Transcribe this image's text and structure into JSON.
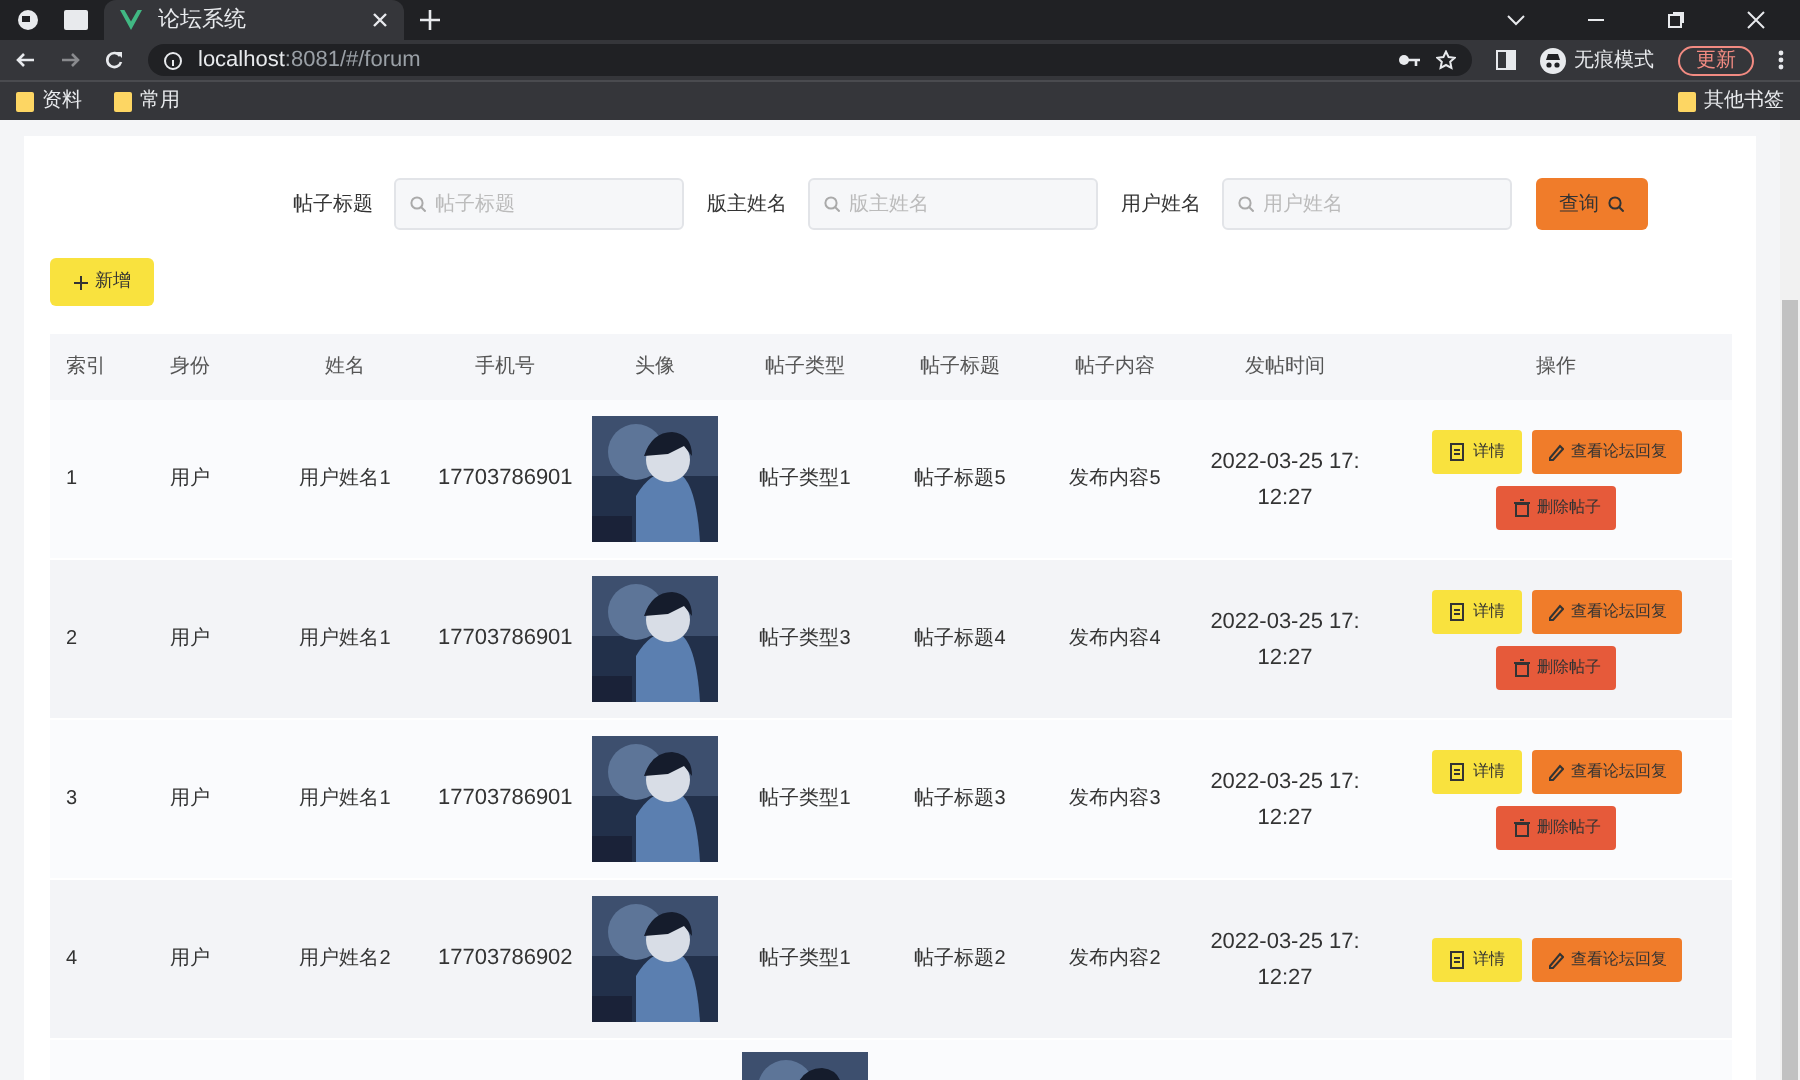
{
  "browser": {
    "tabs": [
      {
        "title": "论坛系统",
        "selected": true
      }
    ],
    "address_host": "localhost",
    "address_rest": ":8081/#/forum",
    "profile_label": "无痕模式",
    "update_button": "更新",
    "bookmarks": [
      {
        "label": "资料"
      },
      {
        "label": "常用"
      }
    ],
    "other_bookmarks": "其他书签"
  },
  "search": {
    "fields": [
      {
        "label": "帖子标题",
        "placeholder": "帖子标题"
      },
      {
        "label": "版主姓名",
        "placeholder": "版主姓名"
      },
      {
        "label": "用户姓名",
        "placeholder": "用户姓名"
      }
    ],
    "button": "查询"
  },
  "add_button": "新增",
  "table": {
    "columns": [
      "索引",
      "身份",
      "姓名",
      "手机号",
      "头像",
      "帖子类型",
      "帖子标题",
      "帖子内容",
      "发帖时间",
      "操作"
    ],
    "rows": [
      {
        "index": "1",
        "role": "用户",
        "name": "用户姓名1",
        "phone": "17703786901",
        "avatar": {
          "kind": "picture"
        },
        "type": "帖子类型1",
        "title": "帖子标题5",
        "content": "发布内容5",
        "time": "2022-03-25 17:12:27",
        "actions": [
          {
            "kind": "detail",
            "label": "详情"
          },
          {
            "kind": "replies",
            "label": "查看论坛回复"
          },
          {
            "kind": "delete",
            "label": "删除帖子"
          }
        ]
      },
      {
        "index": "2",
        "role": "用户",
        "name": "用户姓名1",
        "phone": "17703786901",
        "avatar": {
          "kind": "picture"
        },
        "type": "帖子类型3",
        "title": "帖子标题4",
        "content": "发布内容4",
        "time": "2022-03-25 17:12:27",
        "actions": [
          {
            "kind": "detail",
            "label": "详情"
          },
          {
            "kind": "replies",
            "label": "查看论坛回复"
          },
          {
            "kind": "delete",
            "label": "删除帖子"
          }
        ]
      },
      {
        "index": "3",
        "role": "用户",
        "name": "用户姓名1",
        "phone": "17703786901",
        "avatar": {
          "kind": "picture"
        },
        "type": "帖子类型1",
        "title": "帖子标题3",
        "content": "发布内容3",
        "time": "2022-03-25 17:12:27",
        "actions": [
          {
            "kind": "detail",
            "label": "详情"
          },
          {
            "kind": "replies",
            "label": "查看论坛回复"
          },
          {
            "kind": "delete",
            "label": "删除帖子"
          }
        ]
      },
      {
        "index": "4",
        "role": "用户",
        "name": "用户姓名2",
        "phone": "17703786902",
        "avatar": {
          "kind": "picture"
        },
        "type": "帖子类型1",
        "title": "帖子标题2",
        "content": "发布内容2",
        "time": "2022-03-25 17:12:27",
        "actions": [
          {
            "kind": "detail",
            "label": "详情"
          },
          {
            "kind": "replies",
            "label": "查看论坛回复"
          }
        ]
      }
    ],
    "partial_row": {
      "avatar": {
        "kind": "picture"
      }
    }
  }
}
